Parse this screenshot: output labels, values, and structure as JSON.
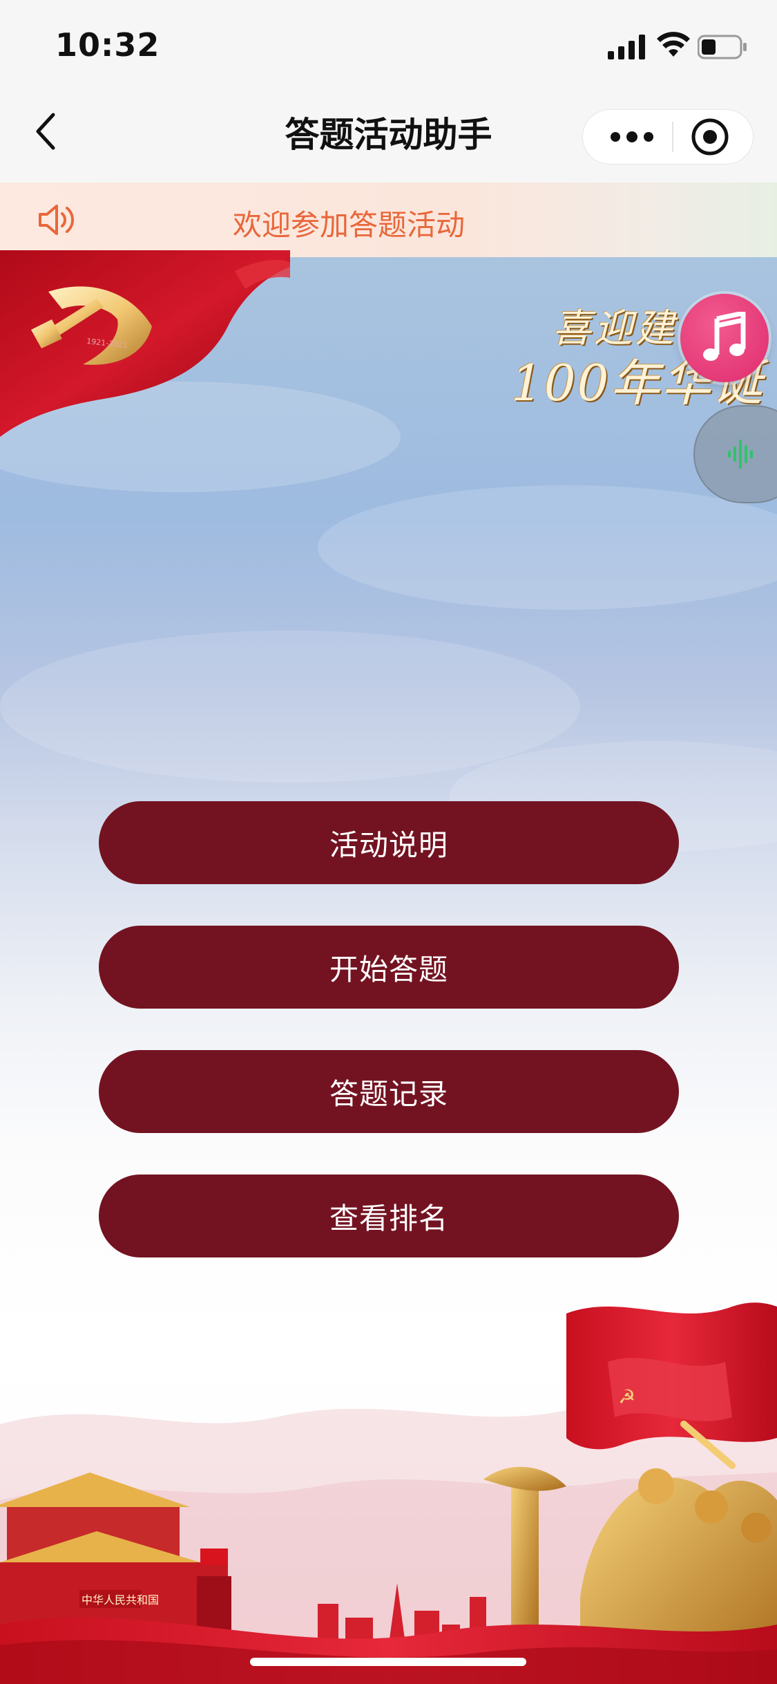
{
  "status_bar": {
    "time": "10:32"
  },
  "nav": {
    "title": "答题活动助手"
  },
  "notice": {
    "text": "欢迎参加答题活动"
  },
  "banner": {
    "line1": "喜迎建",
    "line2": "100年华诞"
  },
  "menu": {
    "items": [
      {
        "label": "活动说明"
      },
      {
        "label": "开始答题"
      },
      {
        "label": "答题记录"
      },
      {
        "label": "查看排名"
      }
    ]
  },
  "colors": {
    "button_bg": "#731321",
    "notice_text": "#e8673a",
    "music_button": "#df2c6d",
    "party_red": "#c4121d"
  },
  "icons": {
    "back": "chevron-left-icon",
    "more": "more-dots-icon",
    "close": "target-circle-icon",
    "speaker": "speaker-icon",
    "music": "music-note-icon",
    "voice": "voice-wave-icon"
  }
}
